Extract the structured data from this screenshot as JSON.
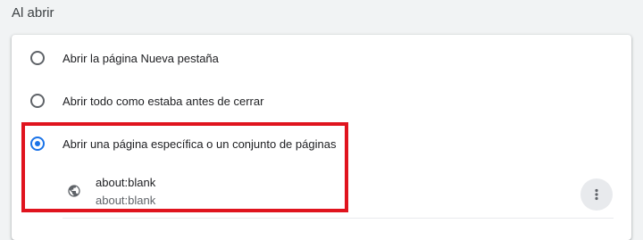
{
  "section": {
    "title": "Al abrir"
  },
  "options": [
    {
      "label": "Abrir la página Nueva pestaña",
      "selected": false
    },
    {
      "label": "Abrir todo como estaba antes de cerrar",
      "selected": false
    },
    {
      "label": "Abrir una página específica o un conjunto de páginas",
      "selected": true
    }
  ],
  "pages": [
    {
      "title": "about:blank",
      "url": "about:blank",
      "icon": "globe-icon"
    }
  ],
  "colors": {
    "accent": "#1a73e8",
    "highlight": "#e0141e",
    "background": "#f1f3f4"
  }
}
